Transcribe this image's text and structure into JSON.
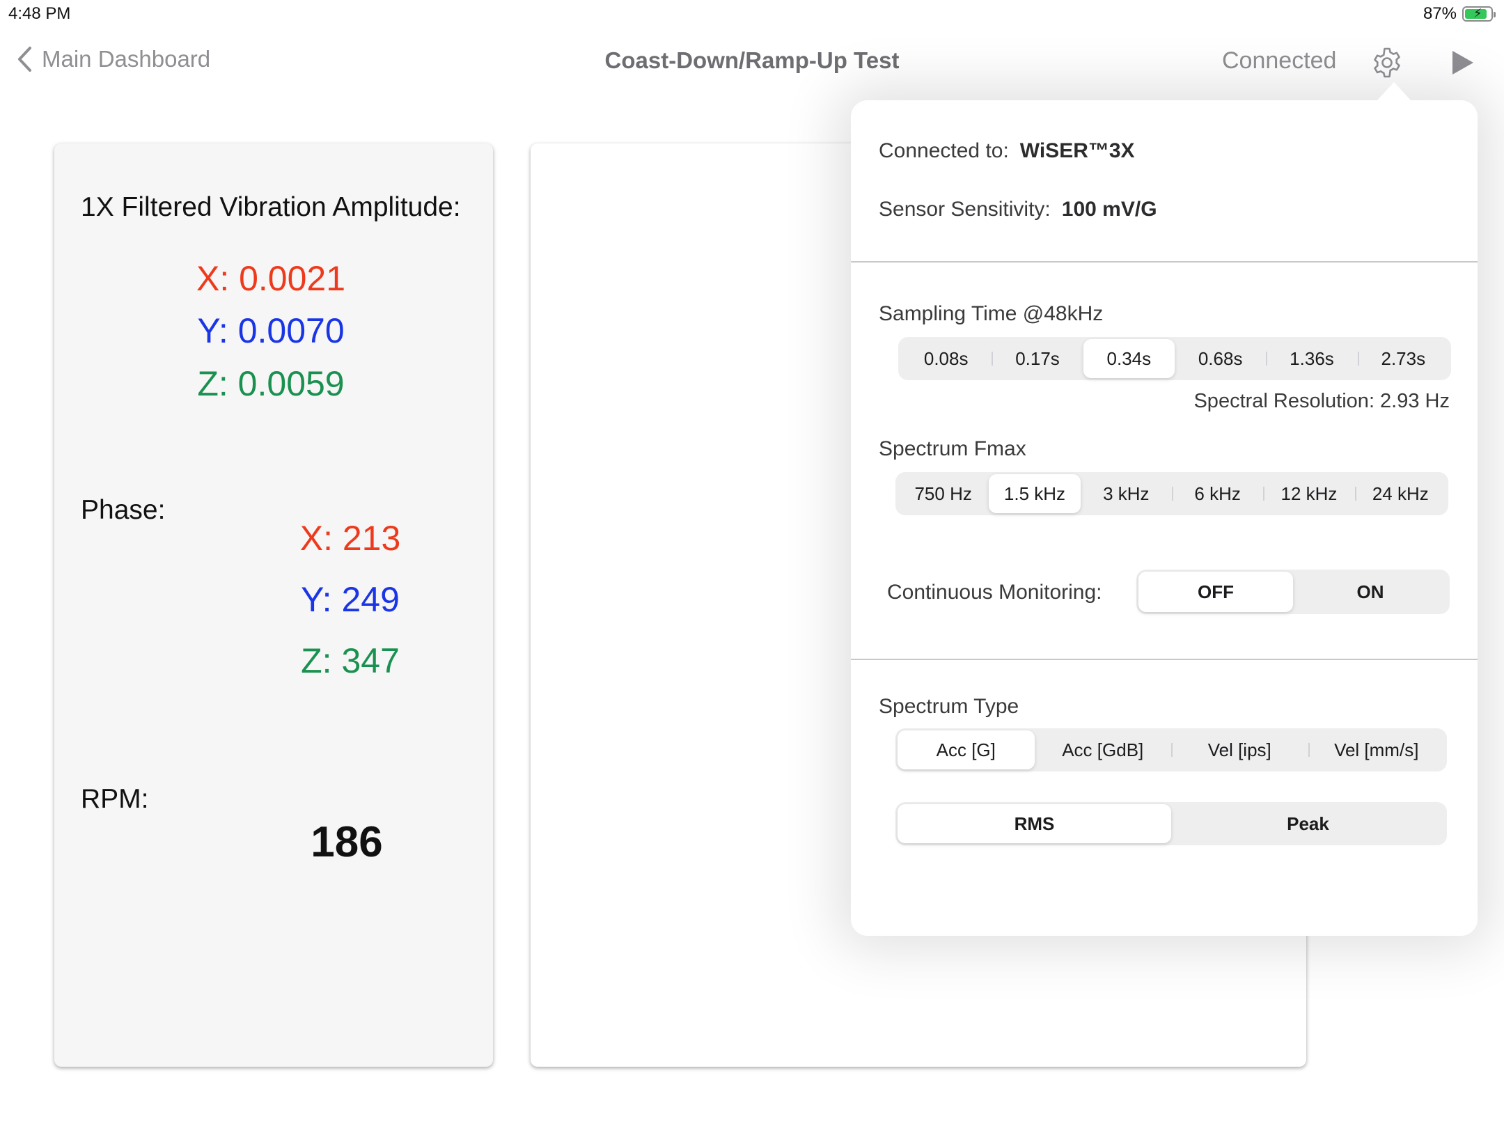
{
  "status": {
    "time": "4:48 PM",
    "battery": "87%",
    "battery_level": 0.87
  },
  "nav": {
    "back_label": "Main Dashboard",
    "title": "Coast-Down/Ramp-Up Test",
    "connection_status": "Connected"
  },
  "vibration": {
    "amplitude_label": "1X Filtered Vibration Amplitude:",
    "x": "X: 0.0021",
    "y": "Y: 0.0070",
    "z": "Z: 0.0059",
    "phase_label": "Phase:",
    "phase_x": "X: 213",
    "phase_y": "Y: 249",
    "phase_z": "Z: 347",
    "rpm_label": "RPM:",
    "rpm_value": "186",
    "colors": {
      "x": "#ee3a1c",
      "y": "#1a35e6",
      "z": "#1a9150"
    }
  },
  "settings": {
    "connected_label": "Connected to:",
    "connected_value": "WiSER™3X",
    "sensitivity_label": "Sensor Sensitivity:",
    "sensitivity_value": "100 mV/G",
    "sampling_title": "Sampling Time @48kHz",
    "sampling_options": [
      "0.08s",
      "0.17s",
      "0.34s",
      "0.68s",
      "1.36s",
      "2.73s"
    ],
    "sampling_selected": "0.34s",
    "resolution": "Spectral Resolution: 2.93 Hz",
    "fmax_title": "Spectrum Fmax",
    "fmax_options": [
      "750 Hz",
      "1.5 kHz",
      "3 kHz",
      "6 kHz",
      "12 kHz",
      "24 kHz"
    ],
    "fmax_selected": "1.5 kHz",
    "continuous_label": "Continuous Monitoring:",
    "continuous_options": [
      "OFF",
      "ON"
    ],
    "continuous_selected": "OFF",
    "spectrum_type_title": "Spectrum Type",
    "spectrum_type_options": [
      "Acc [G]",
      "Acc [GdB]",
      "Vel [ips]",
      "Vel [mm/s]"
    ],
    "spectrum_type_selected": "Acc [G]",
    "measure_options": [
      "RMS",
      "Peak"
    ],
    "measure_selected": "RMS"
  }
}
